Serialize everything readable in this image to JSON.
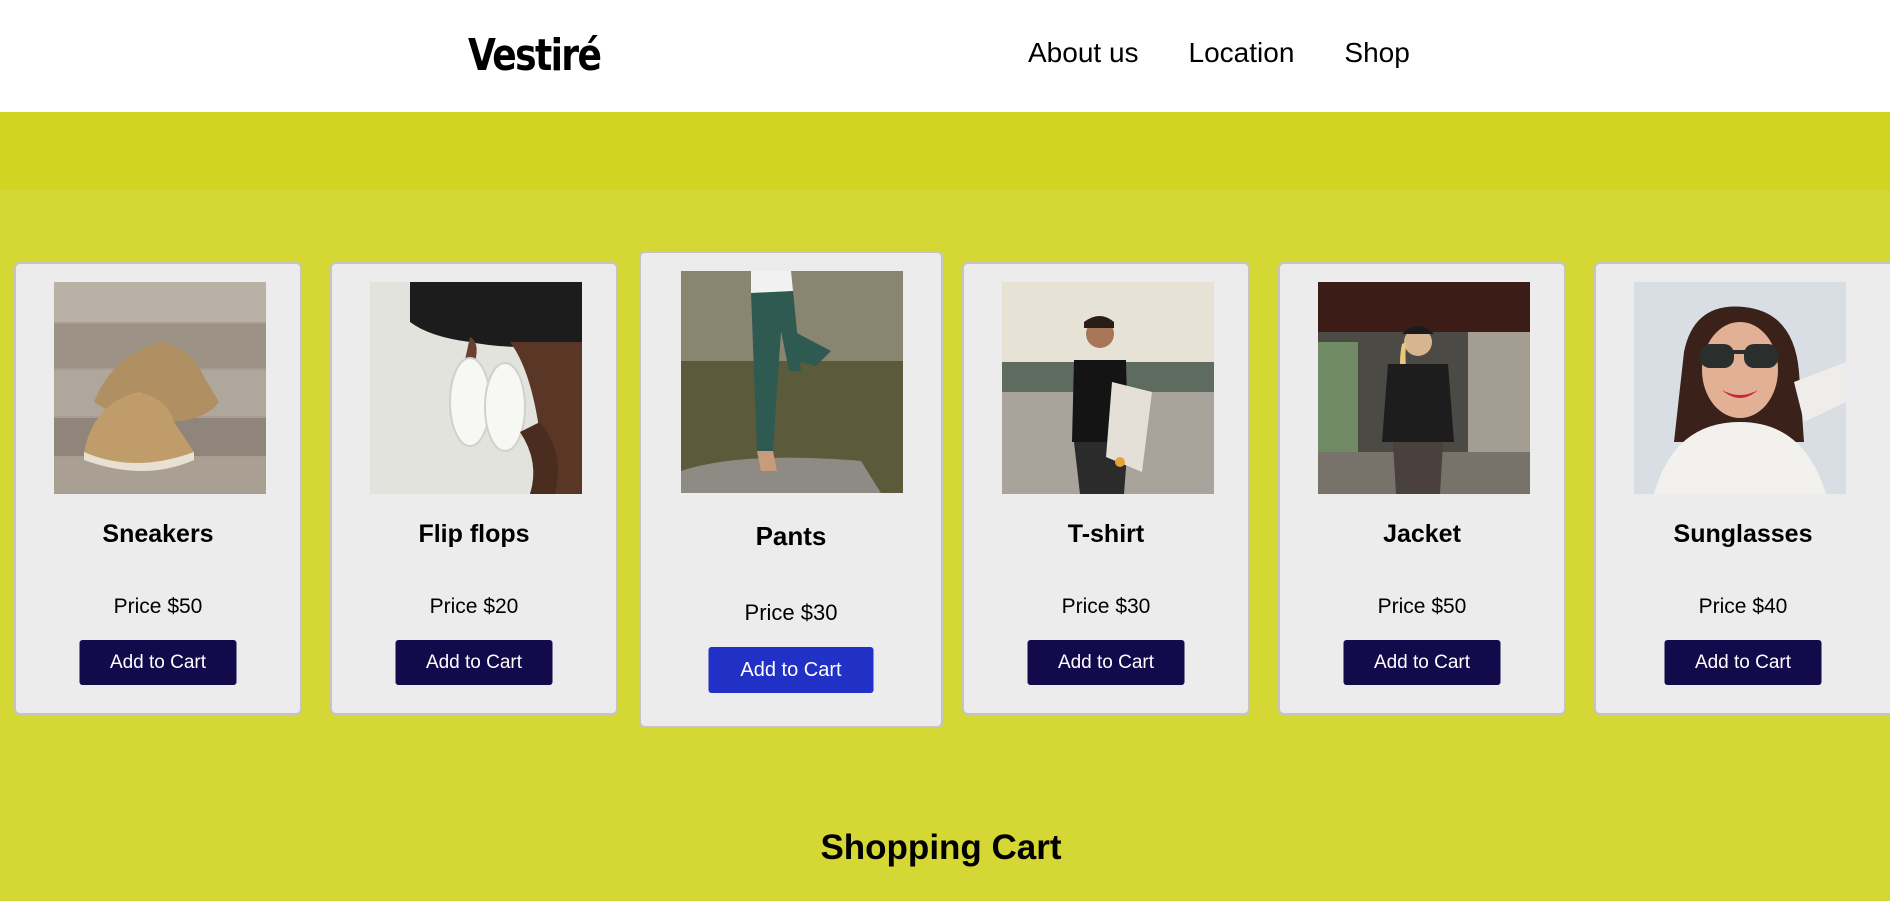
{
  "header": {
    "logo": "Vestiré",
    "nav": [
      "About us",
      "Location",
      "Shop"
    ]
  },
  "colors": {
    "page_background": "#d5d735",
    "banner": "#d2d422",
    "card_background": "#ececec",
    "button": "#120a4b",
    "button_hover": "#2130c5"
  },
  "products": [
    {
      "name": "Sneakers",
      "price": "Price $50",
      "button": "Add to Cart",
      "image": "sneakers-photo"
    },
    {
      "name": "Flip flops",
      "price": "Price $20",
      "button": "Add to Cart",
      "image": "flip-flops-photo"
    },
    {
      "name": "Pants",
      "price": "Price $30",
      "button": "Add to Cart",
      "image": "pants-photo"
    },
    {
      "name": "T-shirt",
      "price": "Price $30",
      "button": "Add to Cart",
      "image": "t-shirt-photo"
    },
    {
      "name": "Jacket",
      "price": "Price $50",
      "button": "Add to Cart",
      "image": "jacket-photo"
    },
    {
      "name": "Sunglasses",
      "price": "Price $40",
      "button": "Add to Cart",
      "image": "sunglasses-photo"
    }
  ],
  "cart": {
    "title": "Shopping Cart"
  }
}
